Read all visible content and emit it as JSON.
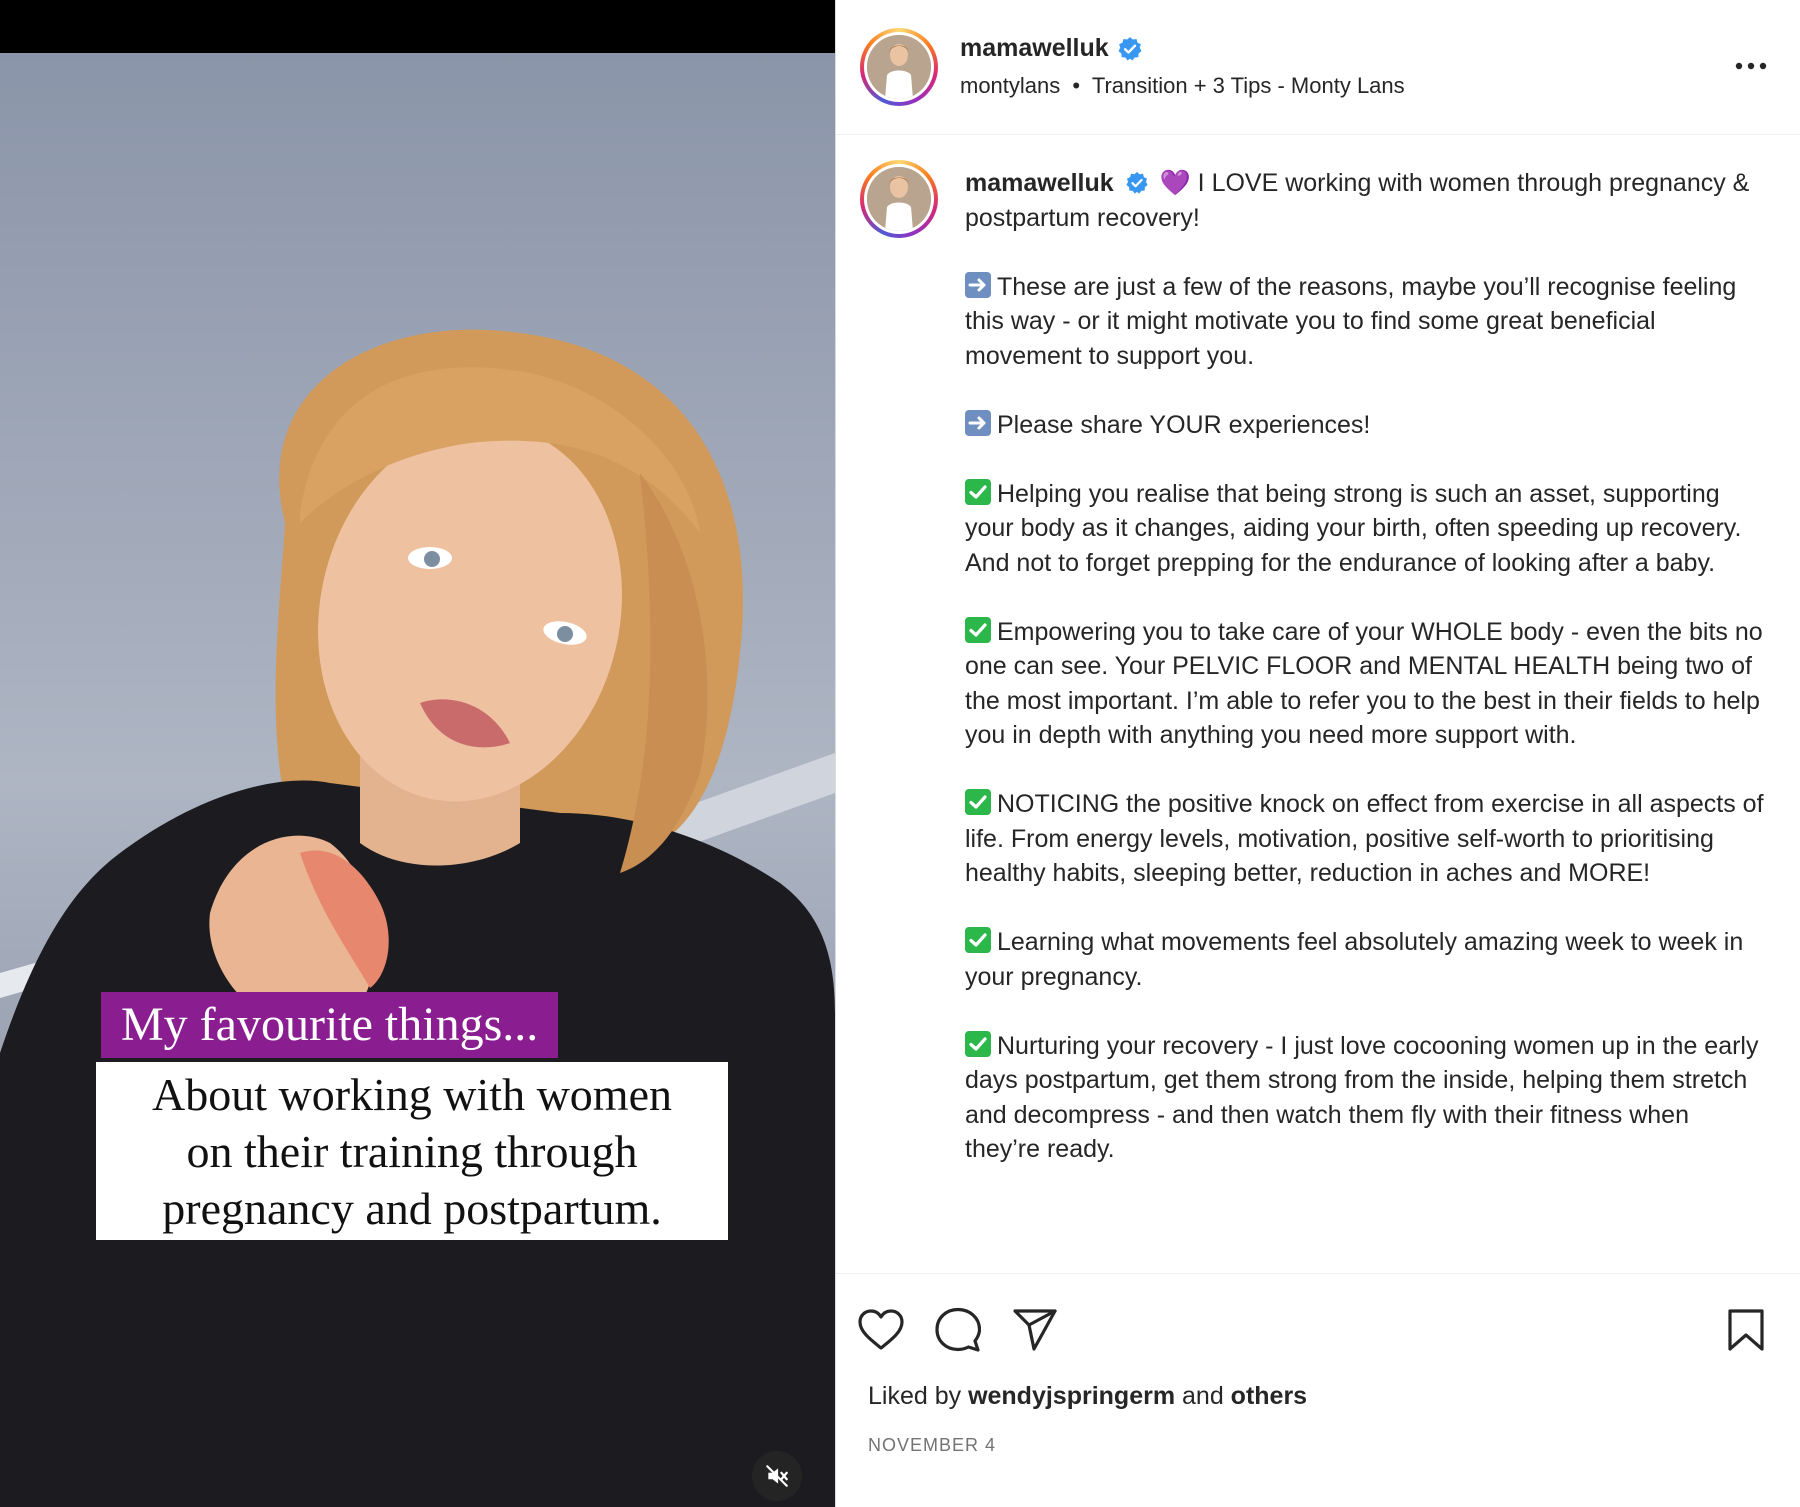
{
  "video": {
    "caption_tag": "My favourite things...",
    "caption_lines": [
      "About working with women",
      "on their training through",
      "pregnancy and postpartum."
    ],
    "mute_icon": "muted-speaker-icon"
  },
  "header": {
    "username": "mamawelluk",
    "verified": true,
    "audio_user": "montylans",
    "separator": "•",
    "audio_title": "Transition + 3 Tips - Monty Lans",
    "more_icon": "more-options-icon"
  },
  "caption": {
    "username": "mamawelluk",
    "intro_emoji": "💜",
    "intro_text": " I LOVE working with women through pregnancy & postpartum recovery!",
    "paragraphs": [
      {
        "icon": "arrow-right-emoji",
        "text": "These are just a few of the reasons, maybe you’ll recognise feeling this way - or it might motivate you to find some great beneficial movement to support you."
      },
      {
        "icon": "arrow-right-emoji",
        "text": "Please share YOUR experiences!"
      },
      {
        "icon": "check-mark-emoji",
        "text": "Helping you realise that being strong is such an asset, supporting your body as it changes, aiding your birth, often speeding up recovery. And not to forget prepping for the endurance of looking after a baby."
      },
      {
        "icon": "check-mark-emoji",
        "text": "Empowering you to take care of your WHOLE body - even the bits no one can see. Your PELVIC FLOOR and MENTAL HEALTH being two of the most important. I’m able to refer you to the best in their fields to help you in depth with anything you need more support with."
      },
      {
        "icon": "check-mark-emoji",
        "text": "NOTICING the positive knock on effect from exercise in all aspects of life. From energy levels, motivation, positive self-worth to prioritising healthy habits, sleeping better, reduction in aches and MORE!"
      },
      {
        "icon": "check-mark-emoji",
        "text": "Learning what movements feel absolutely amazing week to week in your pregnancy."
      },
      {
        "icon": "check-mark-emoji",
        "text": "Nurturing your recovery - I just love cocooning women up in the early days postpartum, get them strong from the inside, helping them stretch and decompress - and then watch them fly with their fitness when they’re ready."
      }
    ]
  },
  "actions": {
    "like_icon": "heart-icon",
    "comment_icon": "comment-bubble-icon",
    "share_icon": "paper-plane-icon",
    "save_icon": "bookmark-icon",
    "liked_prefix": "Liked by ",
    "liked_user": "wendyjspringerm",
    "liked_and": " and ",
    "liked_others": "others",
    "date": "NOVEMBER 4"
  },
  "colors": {
    "caption_tag_bg": "#8a1e91",
    "verified_blue": "#3897f0",
    "text_primary": "#262626",
    "text_secondary": "#737373"
  }
}
